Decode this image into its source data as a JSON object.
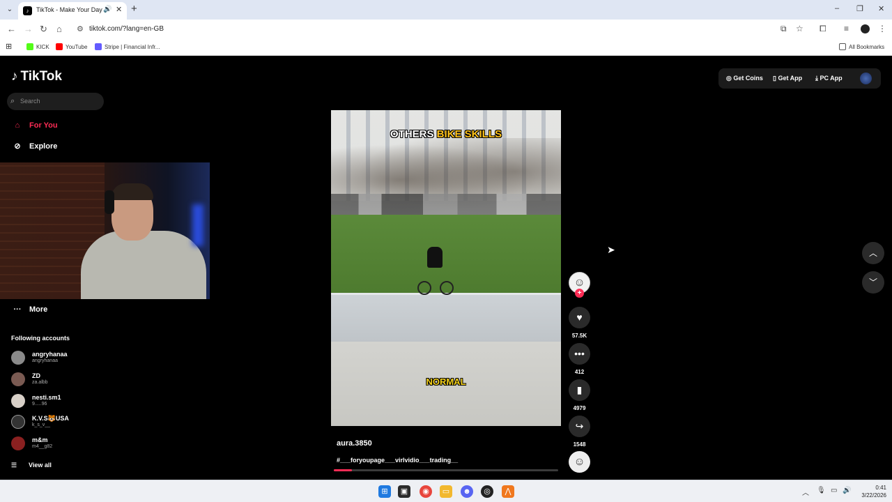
{
  "browser": {
    "tab_title": "TikTok - Make Your Day",
    "tab_favicon": "tiktok-icon",
    "url": "tiktok.com/?lang=en-GB",
    "new_tab_symbol": "+",
    "window_controls": [
      "–",
      "❐",
      "✕"
    ],
    "bookmarks": [
      {
        "label": "KICK",
        "color": "#53fc18"
      },
      {
        "label": "YouTube",
        "color": "#ff0000"
      },
      {
        "label": "Stripe | Financial Infr...",
        "color": "#635bff"
      }
    ],
    "all_bookmarks": "All Bookmarks"
  },
  "tiktok": {
    "logo": "TikTok",
    "search_placeholder": "Search",
    "nav": {
      "for_you": "For You",
      "explore": "Explore",
      "more": "More"
    },
    "accent": "#fe2c55",
    "following_title": "Following accounts",
    "following": [
      {
        "name": "angryhanaa",
        "handle": "angryhanaa"
      },
      {
        "name": "ZD",
        "handle": "za.albb"
      },
      {
        "name": "nesti.sm1",
        "handle": "9.....96"
      },
      {
        "name": "K.V.S🐯USA",
        "handle": "k_s_v__"
      },
      {
        "name": "m&m",
        "handle": "m4__g82"
      }
    ],
    "view_all": "View all",
    "top_actions": {
      "get_coins": "Get Coins",
      "get_app": "Get App",
      "pc_app": "PC App"
    }
  },
  "video": {
    "caption_top_a": "OTHERS",
    "caption_top_b": "BIKE SKILLS",
    "caption_bottom": "NORMAL",
    "author": "aura.3850",
    "description": "#___foryoupage___virlvidio___trading__",
    "progress_fraction": 0.08,
    "likes": "57.5K",
    "comments": "412",
    "saves": "4979",
    "shares": "1548"
  },
  "taskbar": {
    "time": "0:41",
    "date": "3/22/2026"
  }
}
